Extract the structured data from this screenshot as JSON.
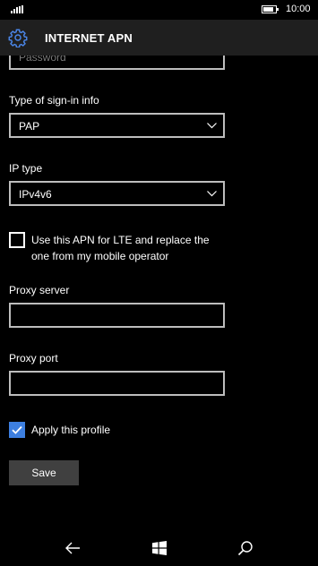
{
  "status": {
    "time": "10:00",
    "battery_level": 0.85,
    "signal_bars": 5
  },
  "header": {
    "title": "INTERNET APN",
    "icon": "gear-icon"
  },
  "form": {
    "password": {
      "placeholder": "Password",
      "value": ""
    },
    "signin_type": {
      "label": "Type of sign-in info",
      "value": "PAP"
    },
    "ip_type": {
      "label": "IP type",
      "value": "IPv4v6"
    },
    "lte_checkbox": {
      "label": "Use this APN for LTE and replace the one from my mobile operator",
      "checked": false
    },
    "proxy_server": {
      "label": "Proxy server",
      "value": ""
    },
    "proxy_port": {
      "label": "Proxy port",
      "value": ""
    },
    "apply_profile": {
      "label": "Apply this profile",
      "checked": true
    },
    "save_label": "Save"
  },
  "colors": {
    "accent": "#3d7fe0",
    "header_bg": "#1f1f1f",
    "button_bg": "#404040"
  },
  "navbar": {
    "icons": [
      "back-arrow-icon",
      "windows-start-icon",
      "search-icon"
    ]
  }
}
